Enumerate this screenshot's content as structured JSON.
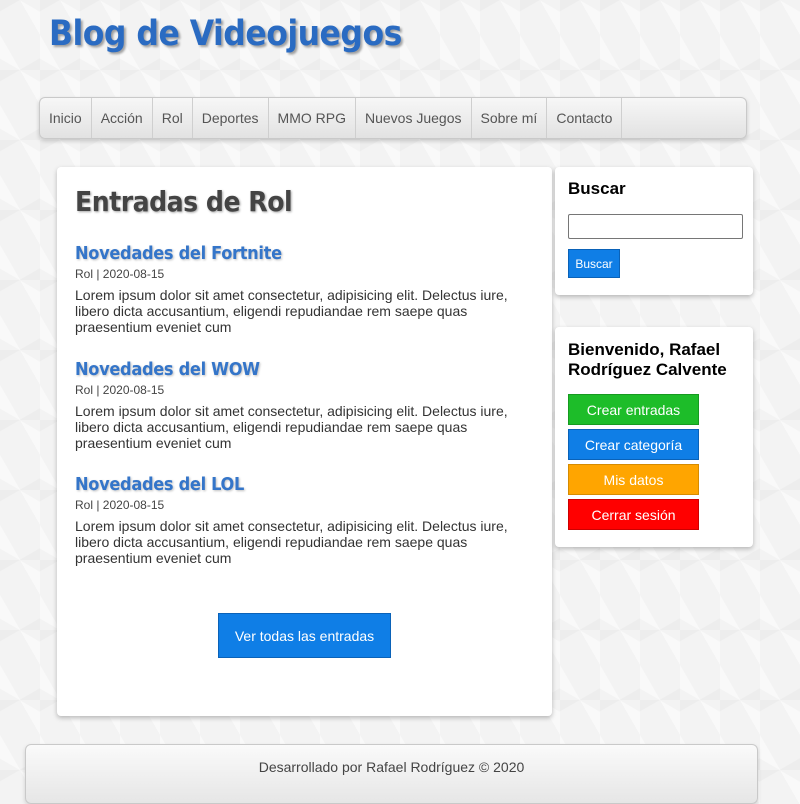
{
  "site": {
    "title": "Blog de Videojuegos"
  },
  "nav": {
    "items": [
      "Inicio",
      "Acción",
      "Rol",
      "Deportes",
      "MMO RPG",
      "Nuevos Juegos",
      "Sobre mí",
      "Contacto"
    ]
  },
  "main": {
    "title": "Entradas de Rol",
    "posts": [
      {
        "title": "Novedades del Fortnite",
        "meta": "Rol | 2020-08-15",
        "excerpt": "Lorem ipsum dolor sit amet consectetur, adipisicing elit. Delectus iure, libero dicta accusantium, eligendi repudiandae rem saepe quas praesentium eveniet cum"
      },
      {
        "title": "Novedades del WOW",
        "meta": "Rol | 2020-08-15",
        "excerpt": "Lorem ipsum dolor sit amet consectetur, adipisicing elit. Delectus iure, libero dicta accusantium, eligendi repudiandae rem saepe quas praesentium eveniet cum"
      },
      {
        "title": "Novedades del LOL",
        "meta": "Rol | 2020-08-15",
        "excerpt": "Lorem ipsum dolor sit amet consectetur, adipisicing elit. Delectus iure, libero dicta accusantium, eligendi repudiandae rem saepe quas praesentium eveniet cum"
      }
    ],
    "view_all_label": "Ver todas las entradas"
  },
  "search": {
    "title": "Buscar",
    "value": "",
    "button_label": "Buscar"
  },
  "user": {
    "greeting": "Bienvenido, Rafael Rodríguez Calvente",
    "buttons": [
      {
        "label": "Crear entradas",
        "bg": "#1dbd29",
        "border": "#169a20",
        "color": "#ffffff"
      },
      {
        "label": "Crear categoría",
        "bg": "#0f7ee6",
        "border": "#0a62b8",
        "color": "#ffffff"
      },
      {
        "label": "Mis datos",
        "bg": "#ffa500",
        "border": "#d68b00",
        "color": "#ffffff"
      },
      {
        "label": "Cerrar sesión",
        "bg": "#ff0000",
        "border": "#cc0000",
        "color": "#ffffff"
      }
    ]
  },
  "footer": {
    "text": "Desarrollado por Rafael Rodríguez © 2020"
  },
  "colors": {
    "brand": "#2a6bc2",
    "link": "#3475c9",
    "primary_button": "#0f7ee6"
  }
}
